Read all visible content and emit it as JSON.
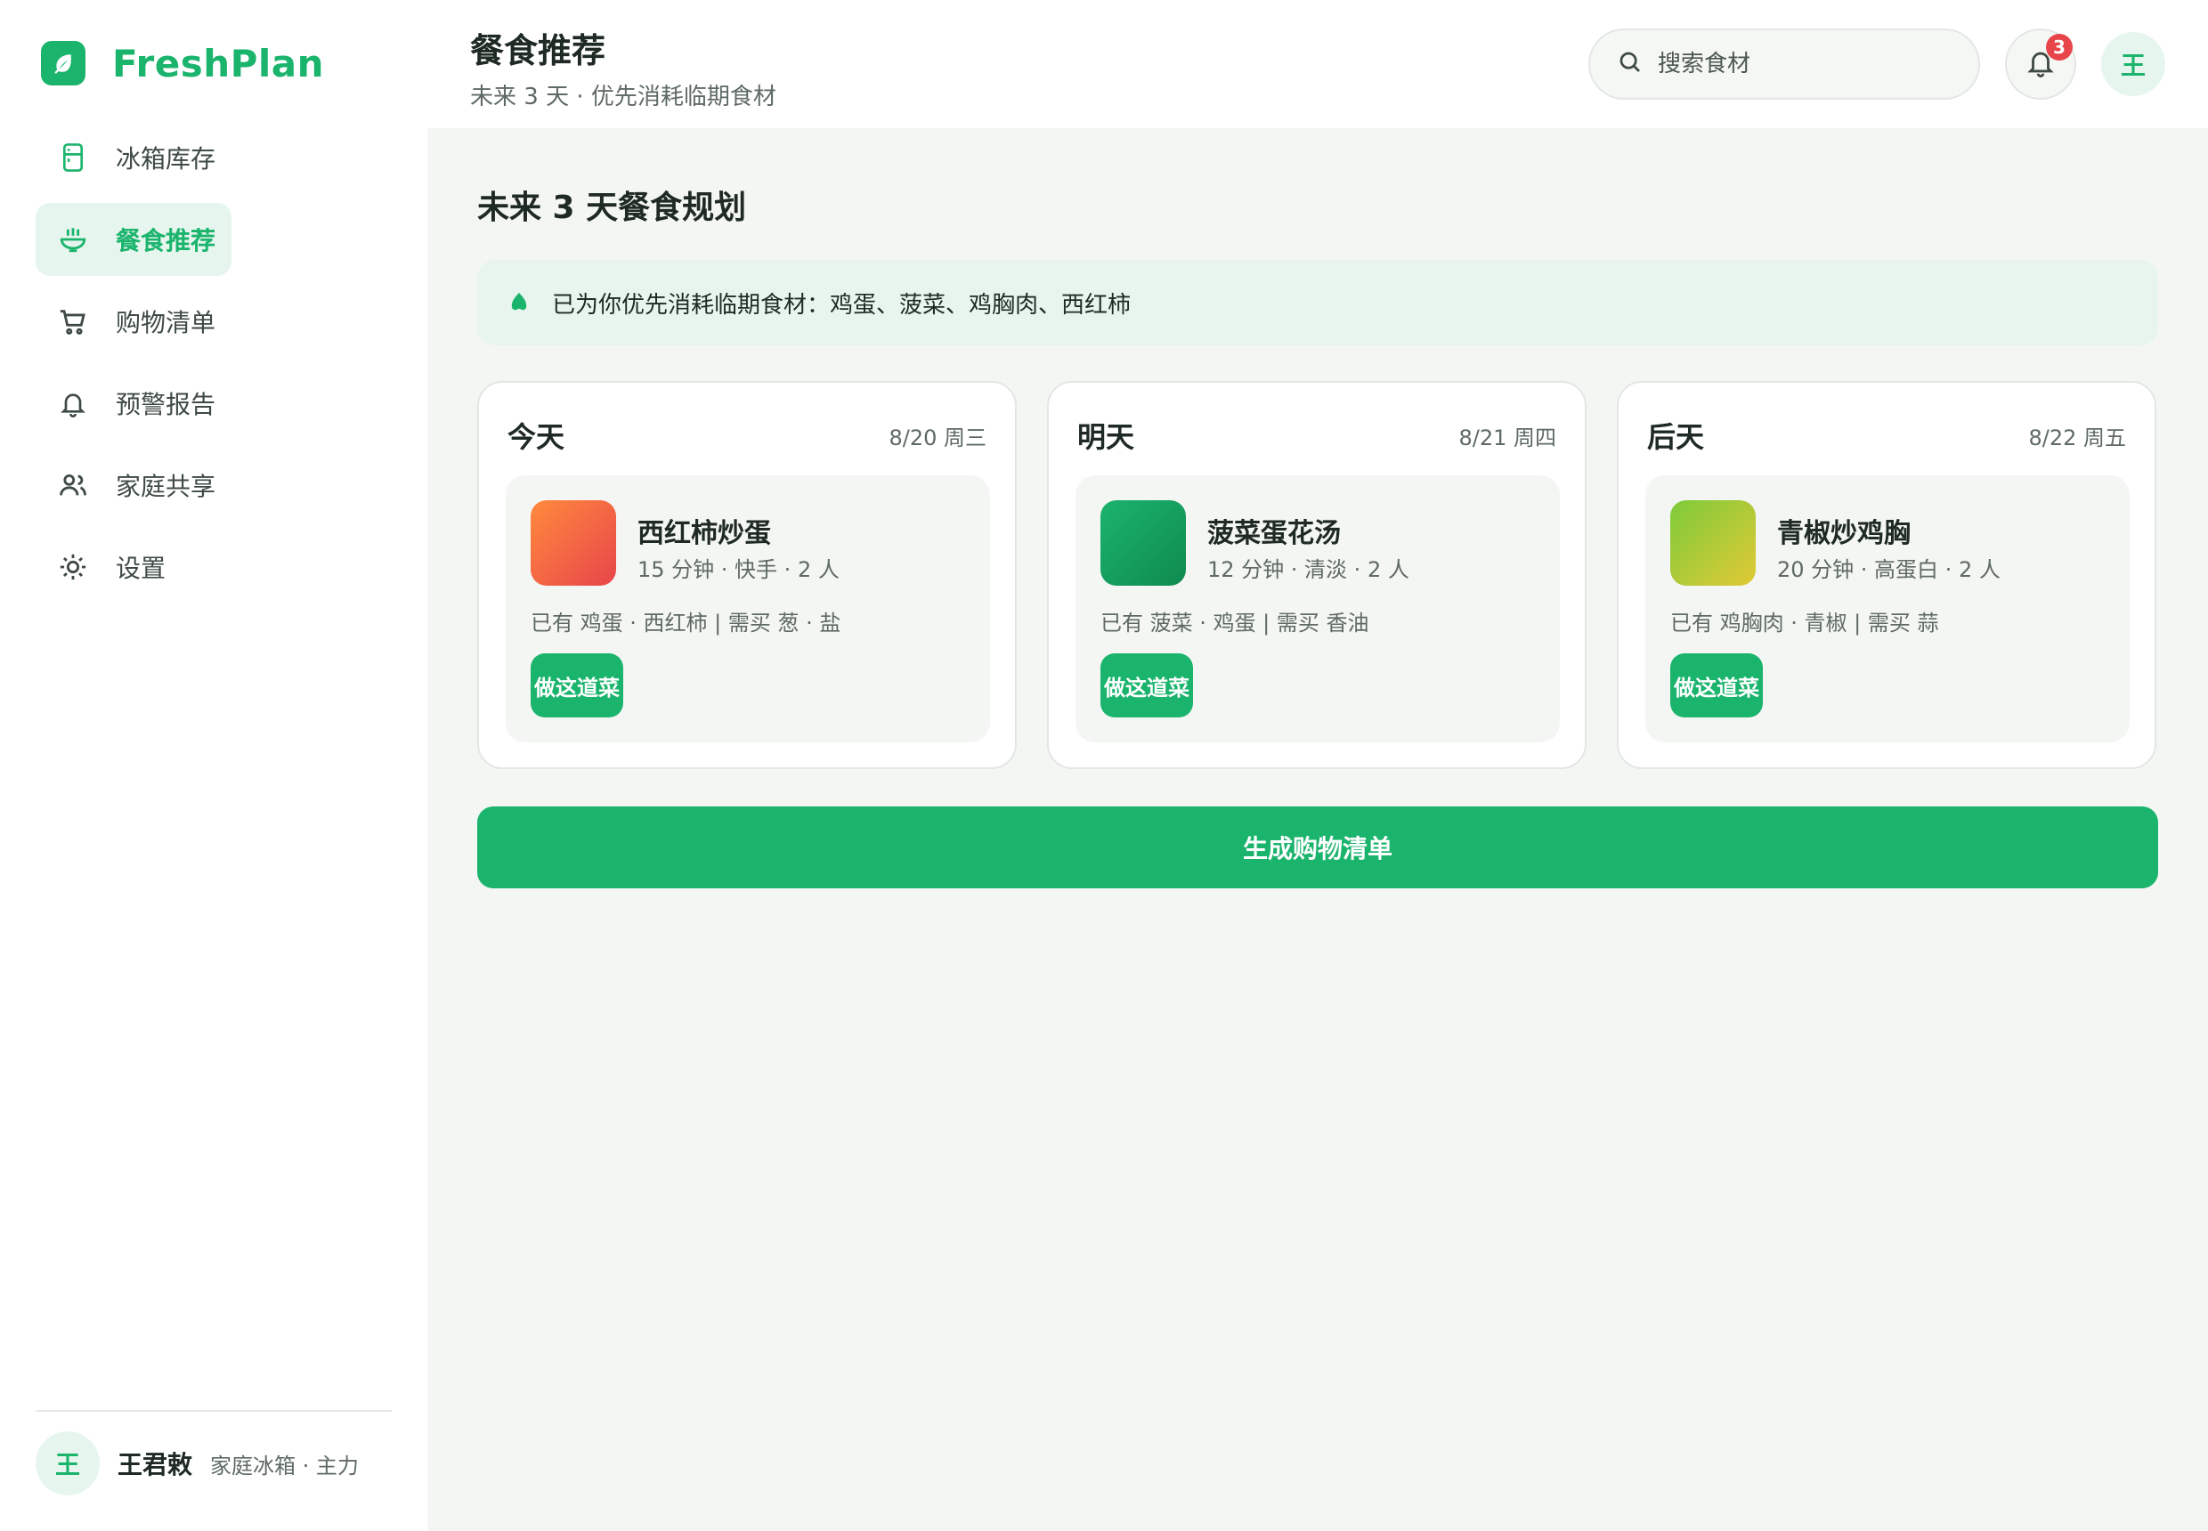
{
  "app": {
    "name": "FreshPlan",
    "logo_icon": "leaf-icon",
    "brand_color": "#1bb46d"
  },
  "sidebar": {
    "items": [
      {
        "label": "冰箱库存",
        "icon": "fridge-icon",
        "active": false
      },
      {
        "label": "餐食推荐",
        "icon": "bowl-icon",
        "active": true
      },
      {
        "label": "购物清单",
        "icon": "cart-icon",
        "active": false
      },
      {
        "label": "预警报告",
        "icon": "bell-icon",
        "active": false
      },
      {
        "label": "家庭共享",
        "icon": "users-icon",
        "active": false
      },
      {
        "label": "设置",
        "icon": "settings-icon",
        "active": false
      }
    ],
    "user": {
      "avatar": "王",
      "name": "王君敕",
      "role": "家庭冰箱 · 主力"
    }
  },
  "header": {
    "title": "餐食推荐",
    "subtitle": "未来 3 天 · 优先消耗临期食材",
    "search_placeholder": "搜索食材",
    "notification_count": "3",
    "avatar": "王"
  },
  "main": {
    "section_title": "未来 3 天餐食规划",
    "notice": "已为你优先消耗临期食材：鸡蛋、菠菜、鸡胸肉、西红柿",
    "days": [
      {
        "name": "今天",
        "date": "8/20 周三",
        "meal": {
          "name": "西红柿炒蛋",
          "meta": "15 分钟 · 快手 · 2 人",
          "ingredients": "已有 鸡蛋 · 西红柿 | 需买 葱 · 盐",
          "button": "做这道菜",
          "colors": [
            "#ff8a3d",
            "#e8454a"
          ]
        }
      },
      {
        "name": "明天",
        "date": "8/21 周四",
        "meal": {
          "name": "菠菜蛋花汤",
          "meta": "12 分钟 · 清淡 · 2 人",
          "ingredients": "已有 菠菜 · 鸡蛋 | 需买 香油",
          "button": "做这道菜",
          "colors": [
            "#1bb46d",
            "#0f8a4f"
          ]
        }
      },
      {
        "name": "后天",
        "date": "8/22 周五",
        "meal": {
          "name": "青椒炒鸡胸",
          "meta": "20 分钟 · 高蛋白 · 2 人",
          "ingredients": "已有 鸡胸肉 · 青椒 | 需买 蒜",
          "button": "做这道菜",
          "colors": [
            "#7ccb3a",
            "#e2c935"
          ]
        }
      }
    ],
    "generate_button": "生成购物清单"
  }
}
